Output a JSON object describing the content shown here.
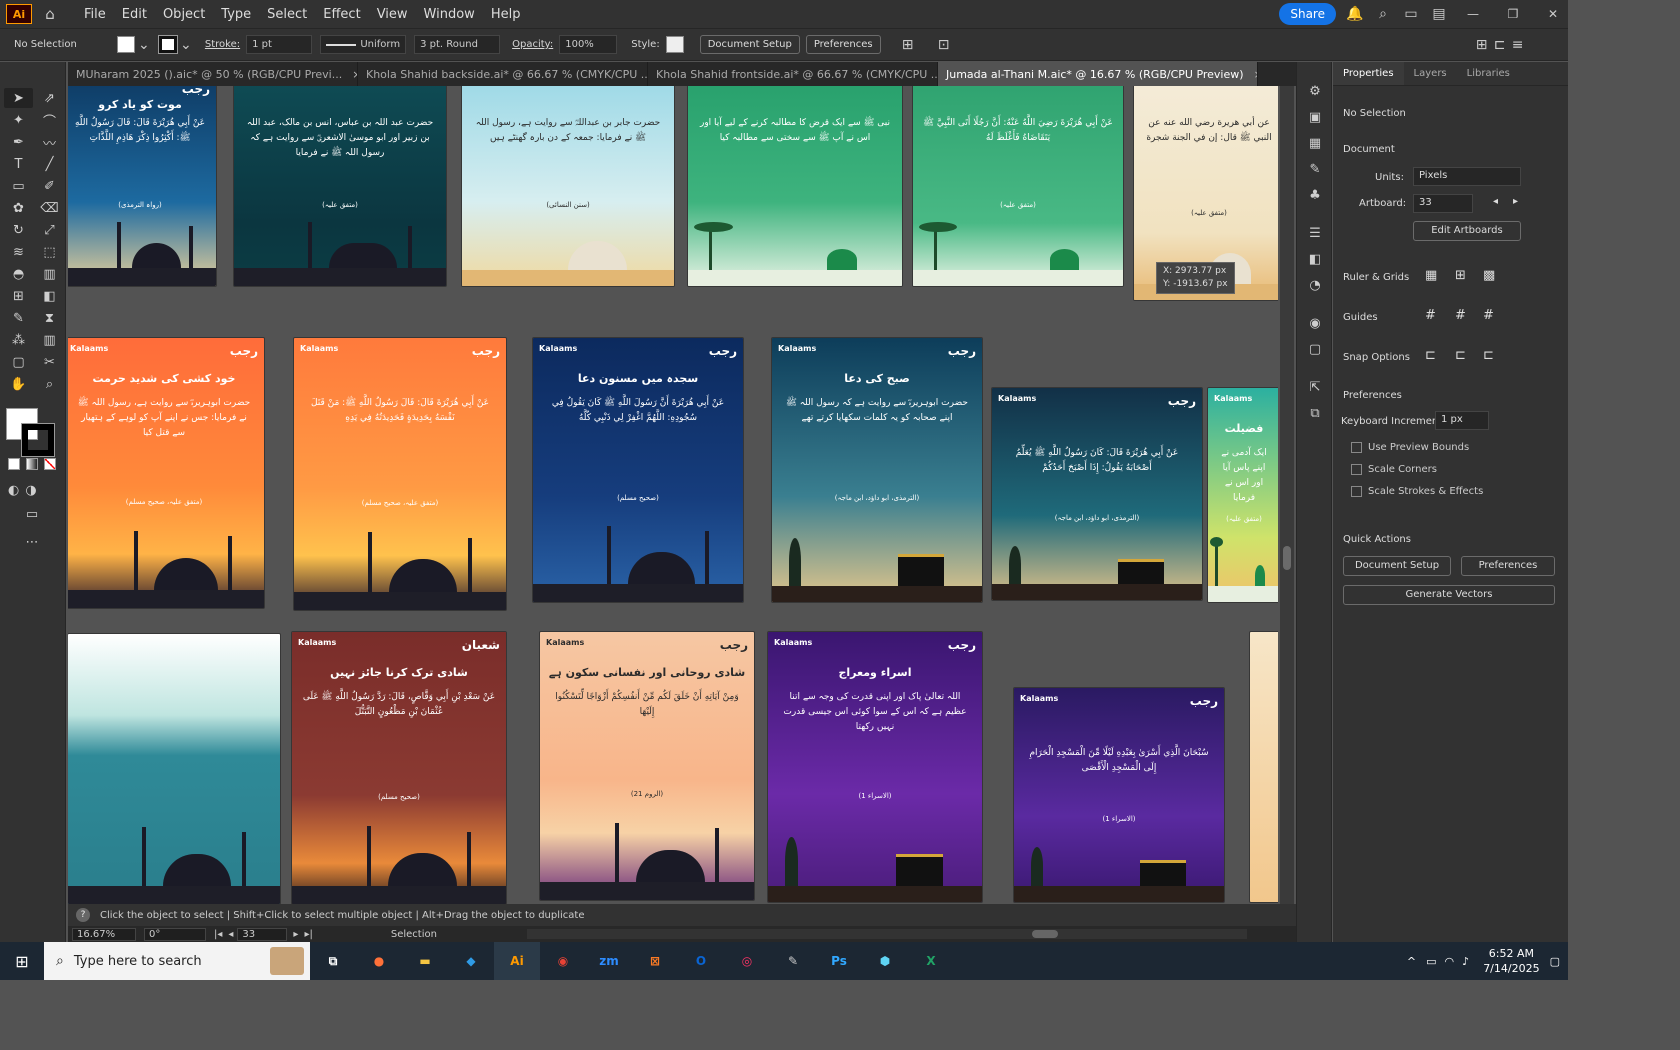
{
  "menubar": {
    "app_logo": "Ai",
    "items": [
      "File",
      "Edit",
      "Object",
      "Type",
      "Select",
      "Effect",
      "View",
      "Window",
      "Help"
    ],
    "share": "Share"
  },
  "control": {
    "selection": "No Selection",
    "stroke_label": "Stroke:",
    "stroke_value": "1 pt",
    "uniform": "Uniform",
    "brush": "3 pt. Round",
    "opacity_label": "Opacity:",
    "opacity_value": "100%",
    "style_label": "Style:",
    "document_setup": "Document Setup",
    "preferences": "Preferences"
  },
  "tabs": [
    {
      "label": "MUharam 2025 ().aic* @ 50 % (RGB/CPU Previ...",
      "close": "×"
    },
    {
      "label": "Khola Shahid backside.ai* @ 66.67 % (CMYK/CPU ...",
      "close": "×"
    },
    {
      "label": "Khola Shahid frontside.ai* @ 66.67 % (CMYK/CPU ...",
      "close": "×"
    },
    {
      "label": "Jumada al-Thani M.aic* @ 16.67 % (RGB/CPU Preview)",
      "close": "×"
    }
  ],
  "tooltip": {
    "x": "X: 2973.77 px",
    "y": "Y: -1913.67 px"
  },
  "artboards": [
    {
      "brand": "",
      "mark": "رجب",
      "title": "موت کو یاد کرو",
      "body": "عَنْ أَبِي هُرَيْرَةَ قَالَ: قَالَ رَسُولُ اللَّهِ ﷺ: أَكْثِرُوا ذِكْرَ هَاذِمِ اللَّذَّاتِ",
      "source": "(رواہ الترمذی)"
    },
    {
      "brand": "",
      "mark": "",
      "title": "",
      "body": "حضرت عبد اللہ بن عباس، انس بن مالک، عبد اللہ بن زبیر اور ابو موسیٰ الاشعریؓ سے روایت ہے کہ رسول اللہ ﷺ نے فرمایا",
      "source": "(متفق علیہ)"
    },
    {
      "brand": "",
      "mark": "",
      "title": "",
      "body": "حضرت جابر بن عبداللہؓ سے روایت ہے، رسول اللہ ﷺ نے فرمایا: جمعہ کے دن بارہ گھنٹے ہیں",
      "source": "(سنن النسائی)"
    },
    {
      "brand": "",
      "mark": "",
      "title": "",
      "body": "نبی ﷺ سے ایک قرض کا مطالبہ کرنے کے لیے آیا اور اس نے آپ ﷺ سے سختی سے مطالبہ کیا",
      "source": ""
    },
    {
      "brand": "",
      "mark": "",
      "title": "",
      "body": "عَنْ أَبِي هُرَيْرَةَ رَضِيَ اللَّهُ عَنْهُ: أَنَّ رَجُلًا أَتَى النَّبِيَّ ﷺ يَتَقَاضَاهُ فَأَغْلَظَ لَهُ",
      "source": "(متفق علیہ)"
    },
    {
      "brand": "",
      "mark": "",
      "title": "",
      "body": "عن أبي هريرة رضي الله عنه عن النبي ﷺ قال: إن في الجنة شجرة",
      "source": "(متفق علیہ)"
    },
    {
      "brand": "Kalaams",
      "mark": "رجب",
      "title": "خود کشی کی شدید حرمت",
      "body": "حضرت ابوہریرہؓ سے روایت ہے، رسول اللہ ﷺ نے فرمایا: جس نے اپنے آپ کو لوہے کے ہتھیار سے قتل کیا",
      "source": "(متفق علیہ، صحیح مسلم)"
    },
    {
      "brand": "Kalaams",
      "mark": "رجب",
      "title": "",
      "body": "عَنْ أَبِي هُرَيْرَةَ قَالَ: قَالَ رَسُولُ اللَّهِ ﷺ: مَنْ قَتَلَ نَفْسَهُ بِحَدِيدَةٍ فَحَدِيدَتُهُ فِي يَدِهِ",
      "source": "(متفق علیہ، صحیح مسلم)"
    },
    {
      "brand": "Kalaams",
      "mark": "رجب",
      "title": "سجدہ میں مسنون دعا",
      "body": "عَنْ أَبِي هُرَيْرَةَ أَنَّ رَسُولَ اللَّهِ ﷺ كَانَ يَقُولُ فِي سُجُودِهِ: اللَّهُمَّ اغْفِرْ لِي ذَنْبِي كُلَّهُ",
      "source": "(صحیح مسلم)"
    },
    {
      "brand": "Kalaams",
      "mark": "رجب",
      "title": "صبح کی دعا",
      "body": "حضرت ابوہریرہؓ سے روایت ہے کہ رسول اللہ ﷺ اپنے صحابہ کو یہ کلمات سکھایا کرتے تھے",
      "source": "(الترمذی، ابو داؤد، ابن ماجہ)"
    },
    {
      "brand": "Kalaams",
      "mark": "رجب",
      "title": "",
      "body": "عَنْ أَبِي هُرَيْرَةَ قَالَ: كَانَ رَسُولُ اللَّهِ ﷺ يُعَلِّمُ أَصْحَابَهُ يَقُولُ: إِذَا أَصْبَحَ أَحَدُكُمْ",
      "source": "(الترمذی، ابو داؤد، ابن ماجہ)"
    },
    {
      "brand": "Kalaams",
      "mark": "",
      "title": "فضیلت",
      "body": "ایک آدمی نے اپنے پاس آیا اور اس نے فرمایا",
      "source": "(متفق علیہ)"
    },
    {
      "brand": "",
      "mark": "",
      "title": "",
      "body": "",
      "source": ""
    },
    {
      "brand": "Kalaams",
      "mark": "شعبان",
      "title": "شادی ترک کرنا جائز نہیں",
      "body": "عَنْ سَعْدِ بْنِ أَبِي وَقَّاصٍ، قَالَ: رَدَّ رَسُولُ اللَّهِ ﷺ عَلَى عُثْمَانَ بْنِ مَظْعُونٍ التَّبَتُّلَ",
      "source": "(صحیح مسلم)"
    },
    {
      "brand": "Kalaams",
      "mark": "رجب",
      "title": "شادی روحانی اور نفسانی سکون ہے",
      "body": "وَمِنْ آيَاتِهِ أَنْ خَلَقَ لَكُم مِّنْ أَنفُسِكُمْ أَزْوَاجًا لِّتَسْكُنُوا إِلَيْهَا",
      "source": "(الروم 21)"
    },
    {
      "brand": "Kalaams",
      "mark": "رجب",
      "title": "اسراء ومعراج",
      "body": "اللہ تعالیٰ پاک اور اپنی قدرت کی وجہ سے اتنا عظیم ہے کہ اس کے سوا کوئی اس جیسی قدرت نہیں رکھتا",
      "source": "(الاسراء 1)"
    },
    {
      "brand": "Kalaams",
      "mark": "رجب",
      "title": "",
      "body": "سُبْحَانَ الَّذِي أَسْرَىٰ بِعَبْدِهِ لَيْلًا مِّنَ الْمَسْجِدِ الْحَرَامِ إِلَى الْمَسْجِدِ الْأَقْصَى",
      "source": "(الاسراء 1)"
    },
    {
      "brand": "",
      "mark": "",
      "title": "",
      "body": "",
      "source": ""
    }
  ],
  "toolbar_icons": [
    "selection-icon",
    "direct-select-icon",
    "magic-wand-icon",
    "lasso-icon",
    "pen-icon",
    "curvature-icon",
    "type-icon",
    "line-icon",
    "rectangle-icon",
    "paintbrush-icon",
    "shaper-icon",
    "eraser-icon",
    "rotate-icon",
    "scale-icon",
    "warp-icon",
    "free-transform-icon",
    "shape-builder-icon",
    "perspective-icon",
    "mesh-icon",
    "gradient-icon",
    "eyedropper-icon",
    "blend-icon",
    "symbol-sprayer-icon",
    "column-graph-icon",
    "artboard-icon",
    "slice-icon",
    "hand-icon",
    "zoom-icon"
  ],
  "panel": {
    "tabs": [
      "Properties",
      "Layers",
      "Libraries"
    ],
    "no_selection": "No Selection",
    "document": "Document",
    "units_label": "Units:",
    "units_value": "Pixels",
    "artboard_label": "Artboard:",
    "artboard_value": "33",
    "edit_artboards": "Edit Artboards",
    "ruler_grids": "Ruler & Grids",
    "guides": "Guides",
    "snap_options": "Snap Options",
    "preferences": "Preferences",
    "keyboard_increment_label": "Keyboard Increment:",
    "keyboard_increment_value": "1 px",
    "use_preview_bounds": "Use Preview Bounds",
    "scale_corners": "Scale Corners",
    "scale_strokes": "Scale Strokes & Effects",
    "quick_actions": "Quick Actions",
    "document_setup": "Document Setup",
    "preferences_btn": "Preferences",
    "generate_vectors": "Generate Vectors"
  },
  "status": {
    "hint": "Click the object to select  |  Shift+Click to select multiple object  |  Alt+Drag the object to duplicate"
  },
  "bottom": {
    "zoom": "16.67%",
    "rotation": "0°",
    "artboard": "33",
    "mode": "Selection"
  },
  "taskbar": {
    "search_placeholder": "Type here to search",
    "time": "6:52 AM",
    "date": "7/14/2025"
  },
  "colors": {
    "accent": "#1473e6",
    "ai_orange": "#ff9a00"
  }
}
